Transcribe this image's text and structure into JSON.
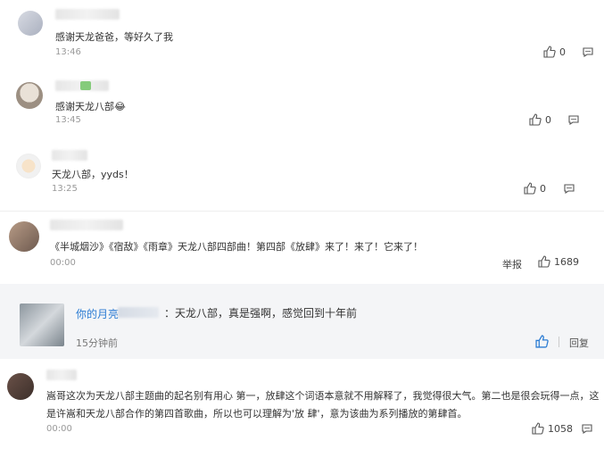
{
  "comments": [
    {
      "text": "感谢天龙爸爸，等好久了我",
      "time": "13:46",
      "likes": "0"
    },
    {
      "text": "感谢天龙八部😂",
      "time": "13:45",
      "likes": "0"
    },
    {
      "text": "天龙八部，yyds！",
      "time": "13:25",
      "likes": "0"
    },
    {
      "text": "《半城烟沙》《宿敌》《雨章》天龙八部四部曲！第四部《放肆》来了！来了！它来了！",
      "time": "00:00",
      "report": "举报",
      "likes": "1689"
    },
    {
      "username": "你的月亮",
      "text": "：天龙八部，真是强啊，感觉回到十年前",
      "time": "15分钟前",
      "reply": "回复"
    },
    {
      "text_line1": "嵩哥这次为天龙八部主题曲的起名别有用心 第一，放肆这个词语本意就不用解释了，我觉得很大气。第二也是很会玩得一点，这",
      "text_line2": "是许嵩和天龙八部合作的第四首歌曲，所以也可以理解为'放 肆'，意为该曲为系列播放的第肆首。",
      "time": "00:00",
      "likes": "1058"
    }
  ],
  "icons": {
    "like": "thumbs-up-icon",
    "more": "comment-more-icon"
  },
  "colors": {
    "accent": "#2b7cd3",
    "text": "#333333",
    "muted": "#999999"
  }
}
